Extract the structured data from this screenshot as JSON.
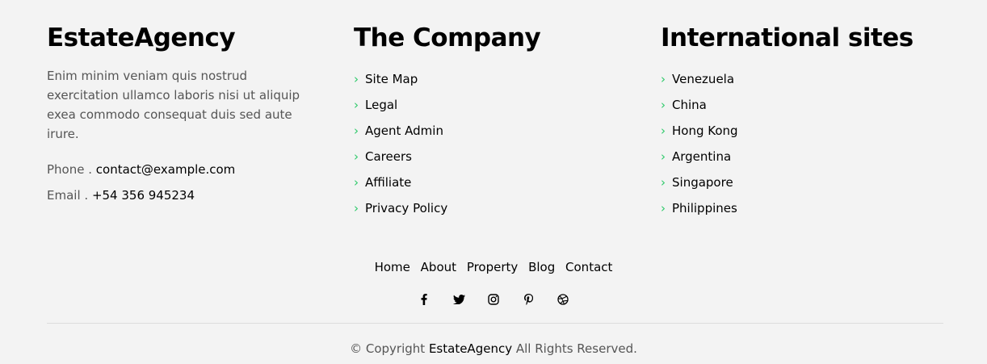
{
  "about": {
    "title": "EstateAgency",
    "description": "Enim minim veniam quis nostrud exercitation ullamco laboris nisi ut aliquip exea commodo consequat duis sed aute irure.",
    "phone_label": "Phone .",
    "phone_value": "contact@example.com",
    "email_label": "Email .",
    "email_value": "+54 356 945234"
  },
  "company": {
    "title": "The Company",
    "links": [
      "Site Map",
      "Legal",
      "Agent Admin",
      "Careers",
      "Affiliate",
      "Privacy Policy"
    ]
  },
  "international": {
    "title": "International sites",
    "links": [
      "Venezuela",
      "China",
      "Hong Kong",
      "Argentina",
      "Singapore",
      "Philippines"
    ]
  },
  "bottom_nav": [
    "Home",
    "About",
    "Property",
    "Blog",
    "Contact"
  ],
  "socials": [
    "facebook-icon",
    "twitter-icon",
    "instagram-icon",
    "pinterest-icon",
    "dribbble-icon"
  ],
  "copyright": {
    "prefix": "© Copyright",
    "brand": "EstateAgency",
    "suffix": "All Rights Reserved."
  },
  "colors": {
    "accent": "#2eca6a",
    "background": "#f3f3f3",
    "muted_text": "#555555"
  }
}
